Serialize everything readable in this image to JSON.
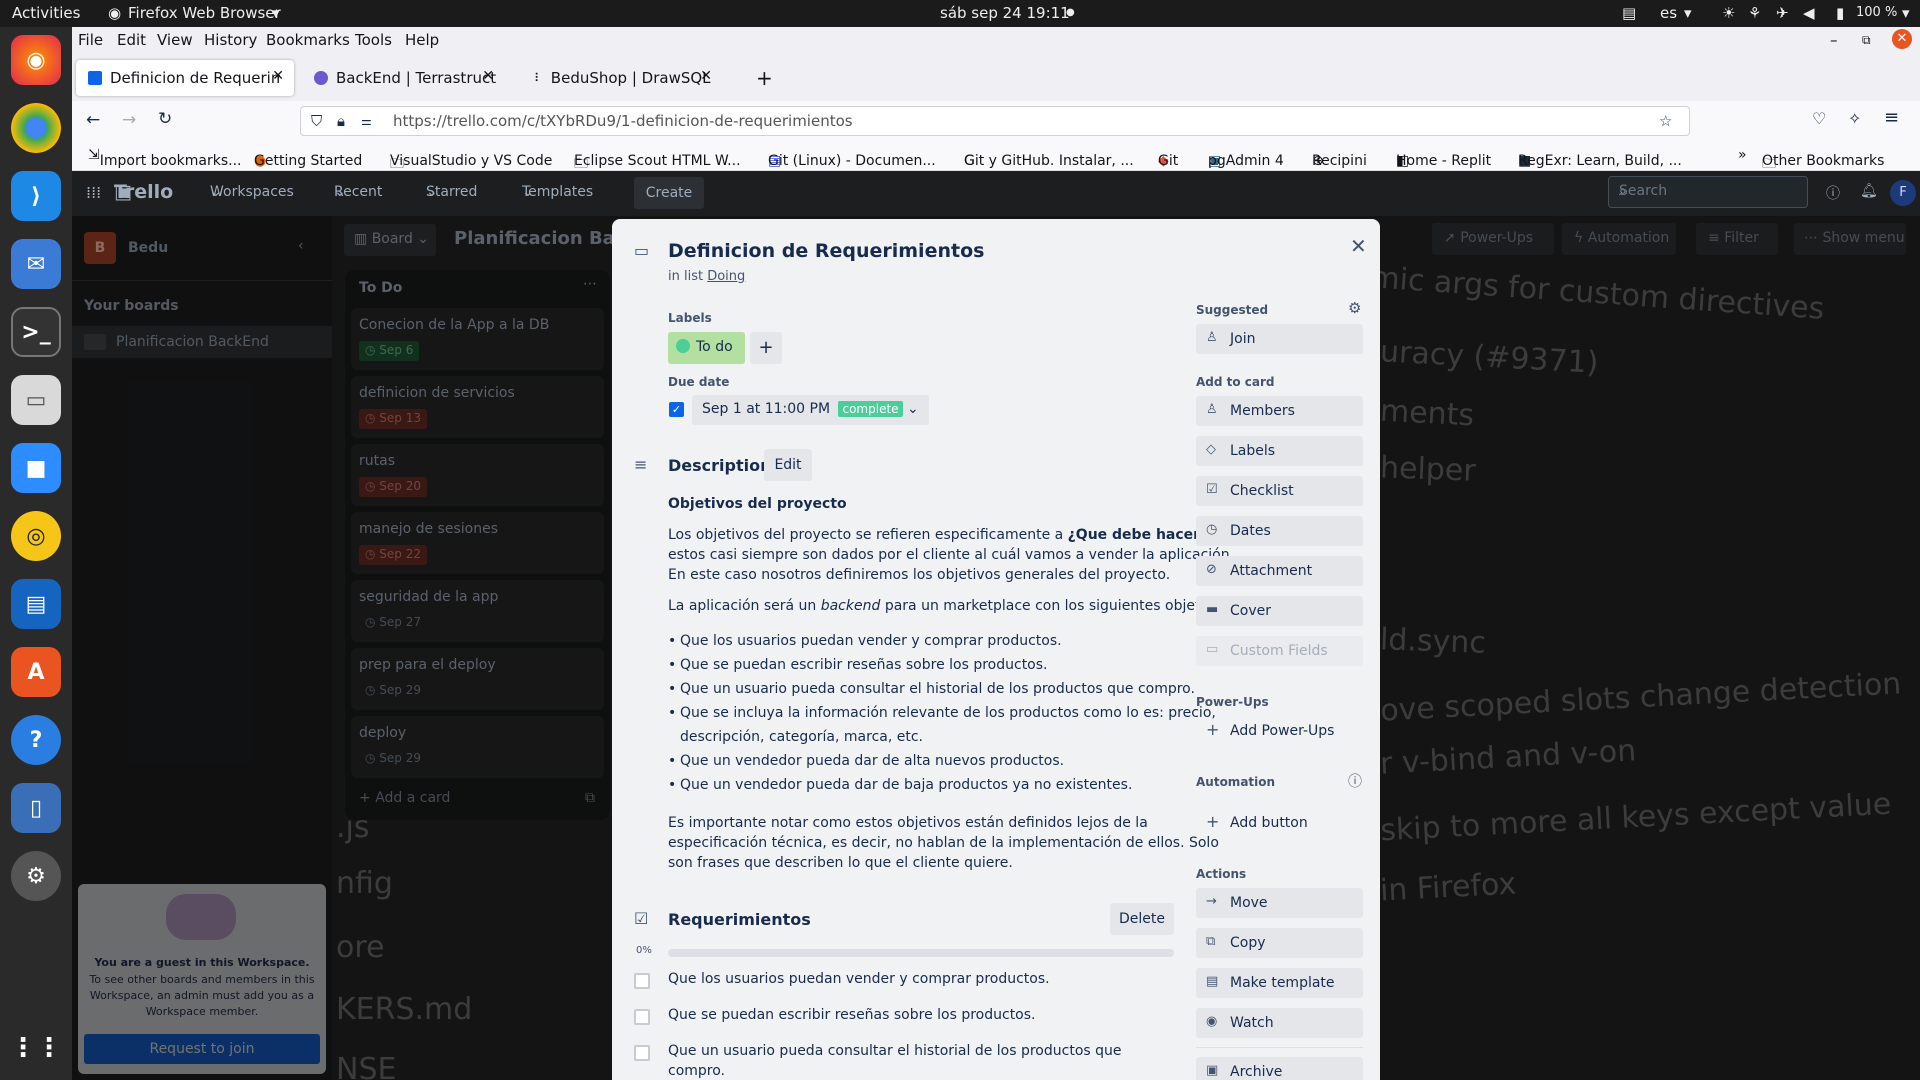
{
  "os": {
    "activities": "Activities",
    "app_name": "Firefox Web Browser",
    "datetime": "sáb sep 24  19:11",
    "lang": "es",
    "battery": "100 %"
  },
  "firefox": {
    "menu": [
      "File",
      "Edit",
      "View",
      "History",
      "Bookmarks",
      "Tools",
      "Help"
    ],
    "tabs": [
      {
        "label": "Definicion de Requerimie"
      },
      {
        "label": "BackEnd | Terrastruct"
      },
      {
        "label": "BeduShop | DrawSQL"
      }
    ],
    "url": "https://trello.com/c/tXYbRDu9/1-definicion-de-requerimientos",
    "bookmarks": [
      "Import bookmarks...",
      "Getting Started",
      "VisualStudio y VS Code",
      "Eclipse Scout HTML W...",
      "Git (Linux) - Documen...",
      "Git y GitHub. Instalar, ...",
      "Git",
      "pgAdmin 4",
      "Recipini",
      "Home - Replit",
      "RegExr: Learn, Build, ..."
    ],
    "other_bookmarks": "Other Bookmarks"
  },
  "trello": {
    "logo": "Trello",
    "nav": [
      "Workspaces",
      "Recent",
      "Starred",
      "Templates"
    ],
    "create": "Create",
    "search_placeholder": "Search",
    "user_initial": "F",
    "workspace_initial": "B",
    "workspace": "Bedu",
    "your_boards": "Your boards",
    "board_item": "Planificacion BackEnd",
    "view": "Board",
    "board_title": "Planificacion Back",
    "board_actions": [
      "Power-Ups",
      "Automation",
      "Filter",
      "Show menu"
    ],
    "guest_title": "You are a guest in this Workspace.",
    "guest_text": "To see other boards and members in this Workspace, an admin must add you as a Workspace member.",
    "request_join": "Request to join",
    "list_title": "To Do",
    "add_card": "Add a card",
    "cards": [
      {
        "title": "Conecion de la App a la DB",
        "date": "Sep 6"
      },
      {
        "title": "definicion de servicios",
        "date": "Sep 13"
      },
      {
        "title": "rutas",
        "date": "Sep 20"
      },
      {
        "title": "manejo de sesiones",
        "date": "Sep 22"
      },
      {
        "title": "seguridad de la app",
        "date": "Sep 27"
      },
      {
        "title": "prep para el deploy",
        "date": "Sep 29"
      },
      {
        "title": "deploy",
        "date": "Sep 29"
      }
    ],
    "background_lines": [
      "mic args for custom directives",
      "uracy (#9371)",
      "ments",
      "helper",
      "ld.sync",
      "ove scoped slots change detection",
      "r v-bind and v-on",
      "skip to more all keys except value",
      "in Firefox",
      ".js",
      "nfig",
      "ore",
      "KERS.md",
      "NSE"
    ]
  },
  "card": {
    "title": "Definicion de Requerimientos",
    "in_list_prefix": "in list",
    "list_name": "Doing",
    "labels_heading": "Labels",
    "label": "To do",
    "due_heading": "Due date",
    "due_date": "Sep 1 at 11:00 PM",
    "due_status": "complete",
    "description_heading": "Description",
    "edit": "Edit",
    "desc_subtitle": "Objetivos del proyecto",
    "p1a": "Los objetivos del proyecto se refieren especificamente a",
    "p1b": "¿Que debe hacer?",
    "p1c": "y",
    "p1d": "estos casi siempre son dados por el cliente al cuál vamos a vender la aplicación.",
    "p1e": "En este caso nosotros definiremos los objetivos generales del proyecto.",
    "p2a": "La aplicación será un",
    "p2b": "backend",
    "p2c": "para un marketplace con los siguientes objetivos:",
    "bullets": [
      "Que los usuarios puedan vender y comprar productos.",
      "Que se puedan escribir reseñas sobre los productos.",
      "Que un usuario pueda consultar el historial de los productos que compro.",
      "Que se incluya la información relevante de los productos como lo es: precio,",
      "descripción, categoría, marca, etc.",
      "Que un vendedor pueda dar de alta nuevos productos.",
      "Que un vendedor pueda dar de baja productos ya no existentes."
    ],
    "p3a": "Es importante notar como estos objetivos están definidos lejos de la",
    "p3b": "especificación técnica, es decir, no hablan de la implementación de ellos. Solo",
    "p3c": "son frases que describen lo que el cliente quiere.",
    "checklist_title": "Requerimientos",
    "delete": "Delete",
    "progress": "0%",
    "checklist": [
      "Que los usuarios puedan vender y comprar productos.",
      "Que se puedan escribir reseñas sobre los productos.",
      "Que un usuario pueda consultar el historial de los productos que",
      "compro."
    ],
    "suggested": "Suggested",
    "join": "Join",
    "add_to_card": "Add to card",
    "add_items": [
      "Members",
      "Labels",
      "Checklist",
      "Dates",
      "Attachment",
      "Cover",
      "Custom Fields"
    ],
    "powerups_heading": "Power-Ups",
    "add_powerups": "Add Power-Ups",
    "automation_heading": "Automation",
    "add_button": "Add button",
    "actions_heading": "Actions",
    "actions": [
      "Move",
      "Copy",
      "Make template",
      "Watch",
      "Archive"
    ]
  }
}
